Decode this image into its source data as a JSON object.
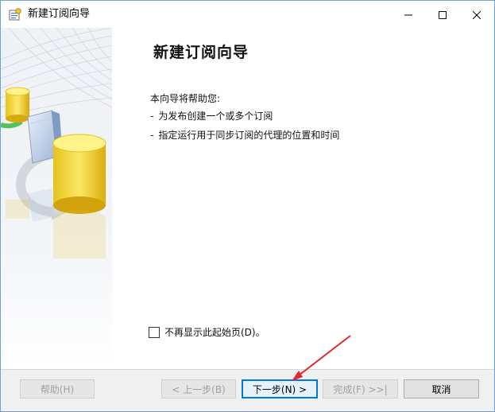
{
  "window": {
    "title": "新建订阅向导"
  },
  "page": {
    "heading": "新建订阅向导",
    "intro": "本向导将帮助您:",
    "bullets": [
      "为发布创建一个或多个订阅",
      "指定运行用于同步订阅的代理的位置和时间"
    ],
    "dont_show_label": "不再显示此起始页(D)。",
    "dont_show_checked": false
  },
  "buttons": {
    "help": "帮助(H)",
    "back": "< 上一步(B)",
    "next": "下一步(N) >",
    "finish": "完成(F) >>|",
    "cancel": "取消"
  },
  "colors": {
    "annotation_arrow": "#e0282f",
    "default_button_border": "#0078d7"
  }
}
